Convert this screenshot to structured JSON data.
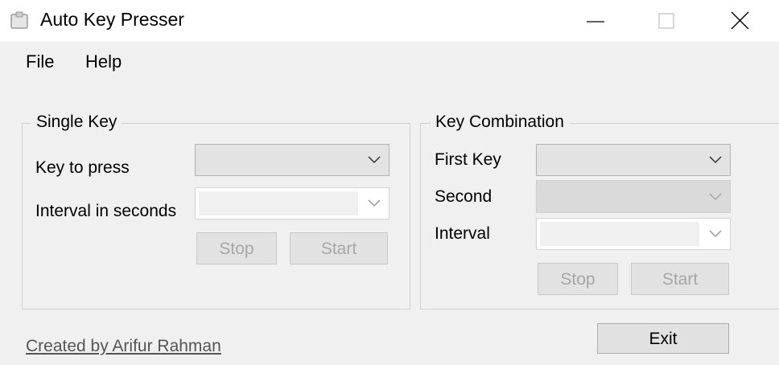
{
  "window": {
    "title": "Auto Key Presser"
  },
  "menu": {
    "items": [
      "File",
      "Help"
    ]
  },
  "single_key": {
    "group_title": "Single Key",
    "key_label": "Key to press",
    "interval_label": "Interval in seconds",
    "stop_label": "Stop",
    "start_label": "Start"
  },
  "key_combination": {
    "group_title": "Key Combination",
    "first_key_label": "First Key",
    "second_label": "Second",
    "interval_label": "Interval",
    "stop_label": "Stop",
    "start_label": "Start"
  },
  "footer": {
    "credit": "Created by Arifur Rahman",
    "exit_label": "Exit"
  },
  "icons": [
    "app-icon",
    "minimize-icon",
    "maximize-icon",
    "close-icon",
    "chevron-down-icon"
  ]
}
